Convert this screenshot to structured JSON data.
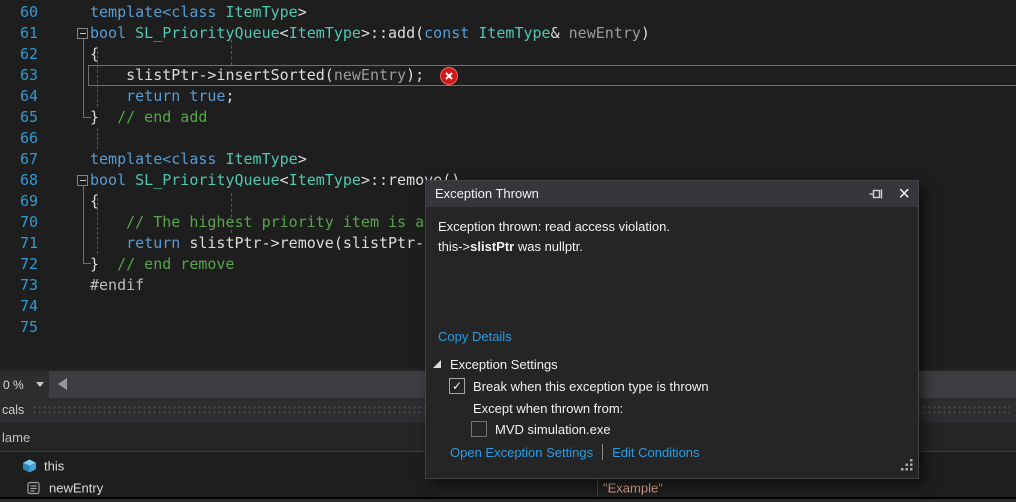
{
  "colors": {
    "kw": "#569CD6",
    "type": "#4EC9B0",
    "plain": "#DCDCDC",
    "param": "#9B9B9B",
    "comment": "#57A64A",
    "pp": "#BEBEBE",
    "lineno": "#2E9BD6",
    "string": "#D69D85",
    "link": "#2B9BE2",
    "error_red": "#D21818"
  },
  "editor": {
    "zoom_value": "0 %",
    "current_line": "63",
    "lines": [
      {
        "n": "60",
        "tokens": [
          {
            "t": "template<class ",
            "c": "kw"
          },
          {
            "t": "ItemType",
            "c": "type"
          },
          {
            "t": ">",
            "c": "plain"
          }
        ]
      },
      {
        "n": "61",
        "fold": true,
        "tokens": [
          {
            "t": "bool",
            "c": "kw"
          },
          {
            "t": " ",
            "c": "plain"
          },
          {
            "t": "SL_PriorityQueue",
            "c": "type"
          },
          {
            "t": "<",
            "c": "plain"
          },
          {
            "t": "ItemType",
            "c": "type"
          },
          {
            "t": ">::add(",
            "c": "plain"
          },
          {
            "t": "const",
            "c": "kw"
          },
          {
            "t": " ",
            "c": "plain"
          },
          {
            "t": "ItemType",
            "c": "type"
          },
          {
            "t": "& ",
            "c": "plain"
          },
          {
            "t": "newEntry",
            "c": "param"
          },
          {
            "t": ")",
            "c": "plain"
          }
        ]
      },
      {
        "n": "62",
        "tokens": [
          {
            "t": "{",
            "c": "plain"
          }
        ]
      },
      {
        "n": "63",
        "tokens": [
          {
            "t": "    slistPtr->insertSorted(",
            "c": "plain"
          },
          {
            "t": "newEntry",
            "c": "param"
          },
          {
            "t": ");",
            "c": "plain"
          }
        ]
      },
      {
        "n": "64",
        "tokens": [
          {
            "t": "    ",
            "c": "plain"
          },
          {
            "t": "return true",
            "c": "kw"
          },
          {
            "t": ";",
            "c": "plain"
          }
        ]
      },
      {
        "n": "65",
        "tokens": [
          {
            "t": "}  ",
            "c": "plain"
          },
          {
            "t": "// end add",
            "c": "comment"
          }
        ]
      },
      {
        "n": "66",
        "tokens": []
      },
      {
        "n": "67",
        "tokens": [
          {
            "t": "template<class ",
            "c": "kw"
          },
          {
            "t": "ItemType",
            "c": "type"
          },
          {
            "t": ">",
            "c": "plain"
          }
        ]
      },
      {
        "n": "68",
        "fold": true,
        "tokens": [
          {
            "t": "bool",
            "c": "kw"
          },
          {
            "t": " ",
            "c": "plain"
          },
          {
            "t": "SL_PriorityQueue",
            "c": "type"
          },
          {
            "t": "<",
            "c": "plain"
          },
          {
            "t": "ItemType",
            "c": "type"
          },
          {
            "t": ">::remove()",
            "c": "plain"
          }
        ]
      },
      {
        "n": "69",
        "tokens": [
          {
            "t": "{",
            "c": "plain"
          }
        ]
      },
      {
        "n": "70",
        "tokens": [
          {
            "t": "    ",
            "c": "plain"
          },
          {
            "t": "// The highest priority item is a",
            "c": "comment"
          }
        ]
      },
      {
        "n": "71",
        "tokens": [
          {
            "t": "    ",
            "c": "plain"
          },
          {
            "t": "return",
            "c": "kw"
          },
          {
            "t": " slistPtr->remove(slistPtr-",
            "c": "plain"
          }
        ]
      },
      {
        "n": "72",
        "tokens": [
          {
            "t": "}  ",
            "c": "plain"
          },
          {
            "t": "// end remove",
            "c": "comment"
          }
        ]
      },
      {
        "n": "73",
        "tokens": [
          {
            "t": "#endif",
            "c": "pp"
          }
        ]
      },
      {
        "n": "74",
        "tokens": []
      },
      {
        "n": "75",
        "tokens": []
      }
    ]
  },
  "dialog": {
    "title": "Exception Thrown",
    "message_line1": "Exception thrown: read access violation.",
    "message_line2_prefix": "this->",
    "message_line2_bold": "slistPtr",
    "message_line2_suffix": " was nullptr.",
    "copy_details_label": "Copy Details",
    "settings_header": "Exception Settings",
    "break_checkbox": {
      "label": "Break when this exception type is thrown",
      "checked": true,
      "glyph": "✓"
    },
    "except_label": "Except when thrown from:",
    "module_checkbox": {
      "label": "MVD simulation.exe",
      "checked": false
    },
    "open_settings_label": "Open Exception Settings",
    "edit_conditions_label": "Edit Conditions"
  },
  "locals": {
    "panel_title": "cals",
    "name_header": "lame",
    "rows": [
      {
        "icon": "object-cube-icon",
        "name": "this",
        "value": ""
      },
      {
        "icon": "field-icon",
        "name": "newEntry",
        "value": "\"Example\""
      }
    ]
  }
}
